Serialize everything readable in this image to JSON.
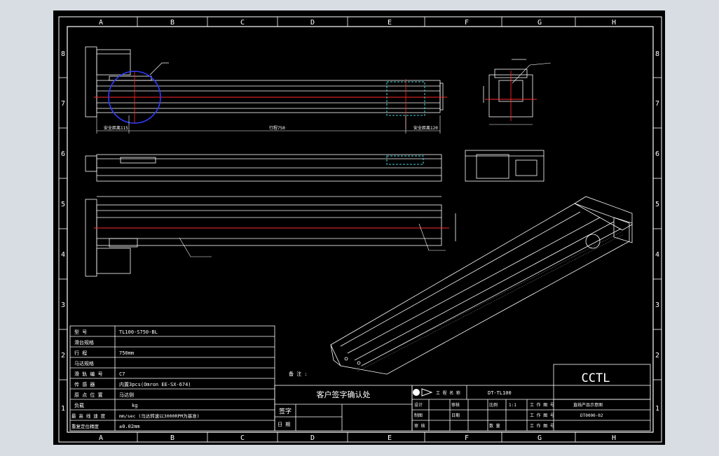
{
  "grid": {
    "columns": [
      "A",
      "B",
      "C",
      "D",
      "E",
      "F",
      "G",
      "H"
    ],
    "rows": [
      "8",
      "7",
      "6",
      "5",
      "4",
      "3",
      "2",
      "1"
    ]
  },
  "brand": "CCTL",
  "model": "DT-TL100",
  "dimensions": {
    "safety_left": "安全距离115",
    "stroke": "行程750",
    "safety_right": "安全距离120"
  },
  "spec_table": [
    {
      "label": "型 号",
      "value": "TL100-S750-BL"
    },
    {
      "label": "滑台规格",
      "value": ""
    },
    {
      "label": "行 程",
      "value": "750mm"
    },
    {
      "label": "马达规格",
      "value": ""
    },
    {
      "label": "滑 轨 编 号",
      "value": "C7"
    },
    {
      "label": "传 感 器",
      "value": "内置3pcs(Omron EE-SX-674)"
    },
    {
      "label": "原 点 位 置",
      "value": "马达侧"
    },
    {
      "label": "负载",
      "value": "kg"
    },
    {
      "label": "最 高 线 速 度",
      "value": "mm/sec (马达转速以3000RPM为基准)"
    },
    {
      "label": "重复定位精度",
      "value": "±0.02mm"
    }
  ],
  "note_label": "备 注 :",
  "confirm_title": "客户签字确认处",
  "confirm_rows": [
    "签字",
    "日 期"
  ],
  "title_block": {
    "project_label": "工 程 名 称",
    "row1": [
      "设计",
      "审核",
      "比例",
      "1:1",
      "工 作 图 号"
    ],
    "row2": [
      "制图",
      "日期",
      "工 作 图 号"
    ],
    "row3": [
      "审 核",
      "数 量",
      "工 作 图 号"
    ],
    "product_desc": "直线产品示意图",
    "drawing_no": "DT0000-02"
  }
}
